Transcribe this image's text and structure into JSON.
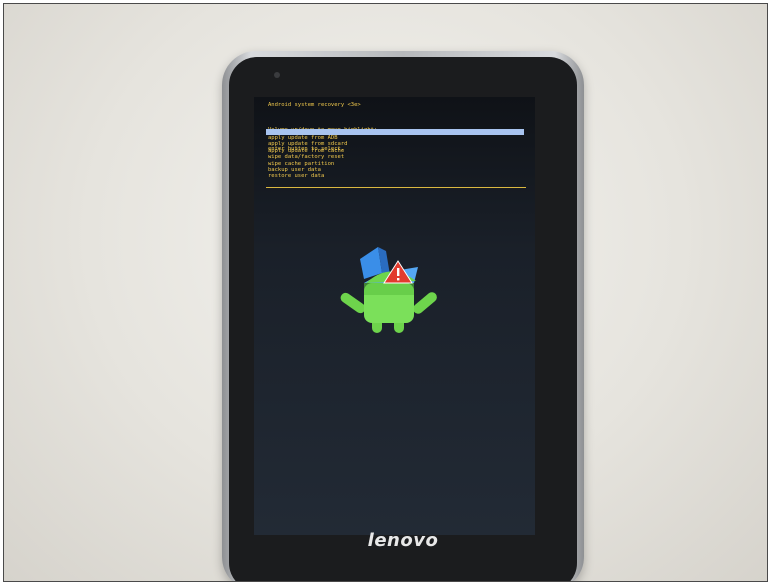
{
  "device": {
    "brand": "lenovo"
  },
  "recovery": {
    "title": "Android system recovery <3e>",
    "instructions": [
      "Volume up/down to move highlight;",
      "enter button to select."
    ],
    "menu": [
      "reboot system now",
      "apply update from ADB",
      "apply update from sdcard",
      "apply update from cache",
      "wipe data/factory reset",
      "wipe cache partition",
      "backup user data",
      "restore user data"
    ],
    "selected_index": 0
  },
  "icons": {
    "robot": "android-robot-warning-icon"
  }
}
